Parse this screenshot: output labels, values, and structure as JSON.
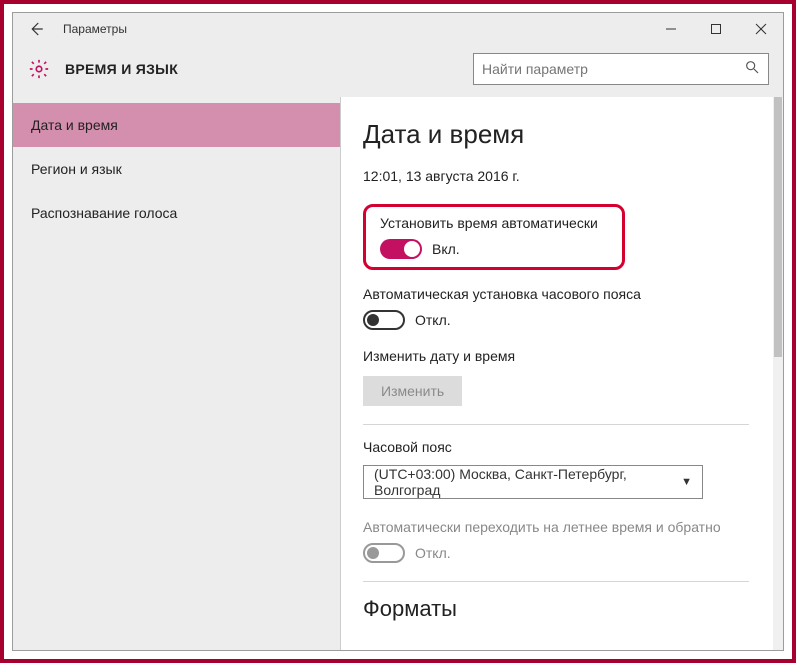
{
  "window": {
    "title": "Параметры"
  },
  "header": {
    "category": "ВРЕМЯ И ЯЗЫК",
    "search_placeholder": "Найти параметр"
  },
  "sidebar": {
    "items": [
      {
        "label": "Дата и время",
        "selected": true
      },
      {
        "label": "Регион и язык",
        "selected": false
      },
      {
        "label": "Распознавание голоса",
        "selected": false
      }
    ]
  },
  "content": {
    "page_title": "Дата и время",
    "current_datetime": "12:01, 13 августа 2016 г.",
    "auto_time": {
      "label": "Установить время автоматически",
      "state": "Вкл.",
      "on": true
    },
    "auto_tz": {
      "label": "Автоматическая установка часового пояса",
      "state": "Откл.",
      "on": false
    },
    "change_dt": {
      "label": "Изменить дату и время",
      "button": "Изменить"
    },
    "timezone": {
      "label": "Часовой пояс",
      "value": "(UTC+03:00) Москва, Санкт-Петербург, Волгоград"
    },
    "dst": {
      "label": "Автоматически переходить на летнее время и обратно",
      "state": "Откл.",
      "on": false,
      "disabled": true
    },
    "formats_title": "Форматы"
  }
}
